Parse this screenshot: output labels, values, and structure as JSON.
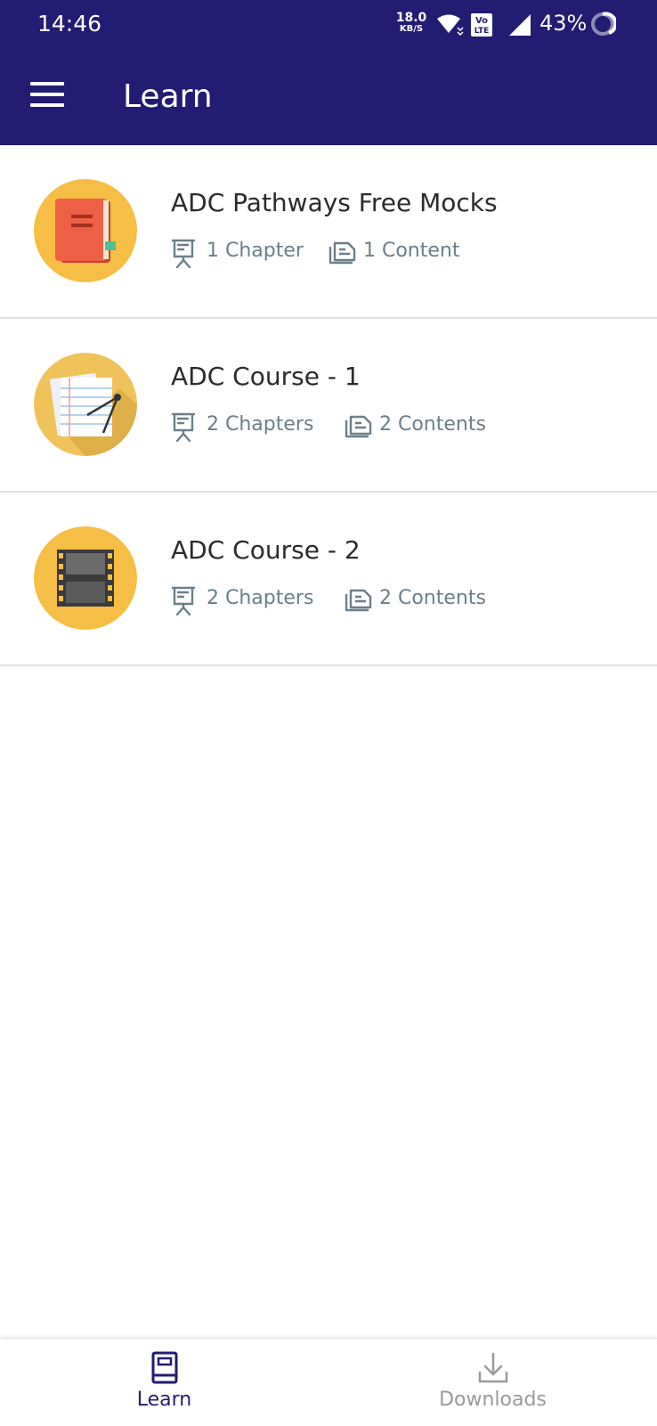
{
  "status_bar": {
    "time": "14:46",
    "net_speed_value": "18.0",
    "net_speed_unit": "KB/S",
    "volte_top": "Vo",
    "volte_bottom": "LTE",
    "battery": "43%"
  },
  "app_bar": {
    "title": "Learn"
  },
  "courses": [
    {
      "title": "ADC Pathways Free Mocks",
      "chapters": "1 Chapter",
      "contents": "1 Content",
      "thumbnail": "notebook-icon"
    },
    {
      "title": "ADC Course - 1",
      "chapters": "2 Chapters",
      "contents": "2 Contents",
      "thumbnail": "papers-compass-icon"
    },
    {
      "title": "ADC Course - 2",
      "chapters": "2 Chapters",
      "contents": "2 Contents",
      "thumbnail": "film-strip-icon"
    }
  ],
  "bottom_nav": {
    "items": [
      {
        "label": "Learn",
        "icon": "book-icon",
        "active": true
      },
      {
        "label": "Downloads",
        "icon": "download-icon",
        "active": false
      }
    ]
  },
  "colors": {
    "primary": "#231c73",
    "meta_text": "#6b7f8b",
    "title_text": "#2b2b2b",
    "inactive_nav": "#9a9a9a",
    "thumb_bg": "#f6be45"
  }
}
